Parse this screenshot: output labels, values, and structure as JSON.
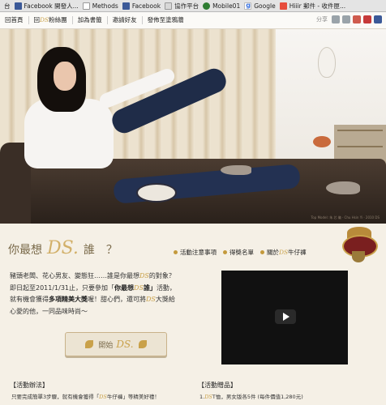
{
  "bookmarks": [
    {
      "label": "台",
      "icon": "page-icon"
    },
    {
      "label": "Facebook 開發人...",
      "icon": "facebook-icon"
    },
    {
      "label": "Methods",
      "icon": "document-icon"
    },
    {
      "label": "Facebook",
      "icon": "facebook-icon"
    },
    {
      "label": "協作平台",
      "icon": "page-icon"
    },
    {
      "label": "Mobile01",
      "icon": "mobile01-icon"
    },
    {
      "label": "Google",
      "icon": "google-icon"
    },
    {
      "label": "Hiiir 郵件 - 收件匣...",
      "icon": "hiiir-mail-icon"
    }
  ],
  "site_nav": {
    "links": [
      "回首頁",
      "回",
      "粉絲團",
      "加為書籤",
      "邀請好友",
      "發佈至塗鴉牆"
    ],
    "ds": "DS",
    "share_label": "分享"
  },
  "hero": {
    "credit": "Top Model: 朱 芯 儀 · Chu Hsin Yi · 2010 DS"
  },
  "headline": {
    "prefix": "你最想",
    "ds": "DS.",
    "suffix": "誰",
    "q": "？"
  },
  "links": [
    {
      "label": "活動注意事項"
    },
    {
      "label": "得獎名單"
    },
    {
      "prefix": "關於",
      "ds": "DS",
      "suffix": "牛仔褲"
    }
  ],
  "intro": {
    "l1a": "豬頭老闆、花心男友、變態狂……誰是你最想",
    "ds1": "DS",
    "l1b": "的對象？",
    "l2a": "即日起至2011/1/31止，只要參加「",
    "bold1a": "你最想",
    "ds2": "DS",
    "bold1b": "誰」",
    "l2b": "活動，",
    "l3a": "就有機會獲得",
    "bold2": "多項精美大獎",
    "l3b": "喔！甜心們，還可將",
    "ds3": "DS",
    "l3c": "大獎給",
    "l4": "心愛的他，一同品味時尚～"
  },
  "start_button": {
    "label": "開始",
    "ds": "DS."
  },
  "sections": {
    "left_title": "【活動辦法】",
    "left_a": "只要完成簡單3步驟，就有機會獲得「",
    "left_ds": "DS",
    "left_b": "牛仔褲」等精美好禮！",
    "right_title": "【活動贈品】",
    "right_a": "1.",
    "right_ds": "DS",
    "right_b": "T恤，男女版各5件 (每件價值1,280元)"
  }
}
